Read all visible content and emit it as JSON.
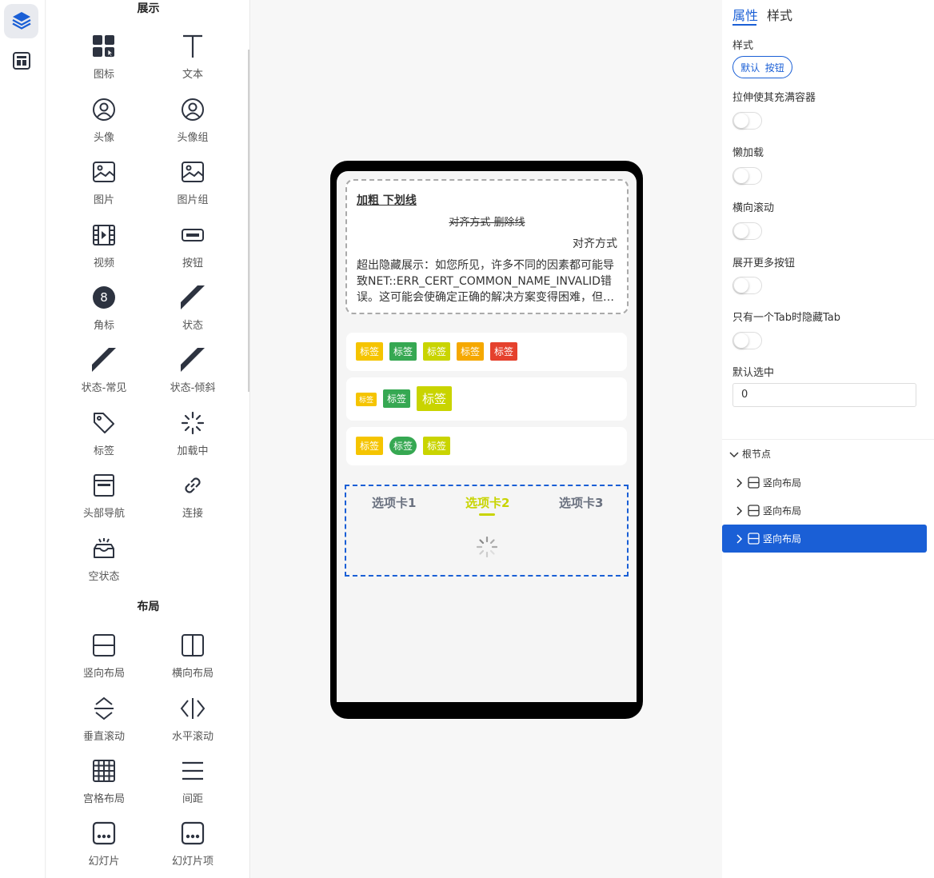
{
  "palette": {
    "display_title": "展示",
    "layout_title": "布局",
    "display_items": [
      {
        "label": "图标",
        "icon": "grid-apps-icon"
      },
      {
        "label": "文本",
        "icon": "text-t-icon"
      },
      {
        "label": "头像",
        "icon": "avatar-icon"
      },
      {
        "label": "头像组",
        "icon": "avatar-group-icon"
      },
      {
        "label": "图片",
        "icon": "image-icon"
      },
      {
        "label": "图片组",
        "icon": "image-group-icon"
      },
      {
        "label": "视频",
        "icon": "video-icon"
      },
      {
        "label": "按钮",
        "icon": "button-icon"
      },
      {
        "label": "角标",
        "icon": "badge-icon",
        "badge_text": "8"
      },
      {
        "label": "状态",
        "icon": "status-icon"
      },
      {
        "label": "状态-常见",
        "icon": "status-common-icon"
      },
      {
        "label": "状态-倾斜",
        "icon": "status-tilt-icon"
      },
      {
        "label": "标签",
        "icon": "tag-icon"
      },
      {
        "label": "加载中",
        "icon": "loading-icon"
      },
      {
        "label": "头部导航",
        "icon": "header-nav-icon"
      },
      {
        "label": "连接",
        "icon": "link-icon"
      },
      {
        "label": "空状态",
        "icon": "empty-inbox-icon"
      }
    ],
    "layout_items": [
      {
        "label": "竖向布局",
        "icon": "vertical-layout-icon"
      },
      {
        "label": "横向布局",
        "icon": "horizontal-layout-icon"
      },
      {
        "label": "垂直滚动",
        "icon": "vertical-scroll-icon"
      },
      {
        "label": "水平滚动",
        "icon": "horizontal-scroll-icon"
      },
      {
        "label": "宫格布局",
        "icon": "grid-layout-icon"
      },
      {
        "label": "间距",
        "icon": "spacing-icon"
      },
      {
        "label": "幻灯片",
        "icon": "slideshow-icon"
      },
      {
        "label": "幻灯片项",
        "icon": "slide-item-icon"
      }
    ]
  },
  "preview": {
    "text_line1": "加粗 下划线",
    "text_line2": "对齐方式 删除线",
    "text_line3": "对齐方式",
    "text_para": "超出隐藏展示：如您所见，许多不同的因素都可能导致NET::ERR_CERT_COMMON_NAME_INVALID错误。这可能会使确定正确的解决方案变得困难，但…",
    "tag_text": "标签",
    "tabs": [
      "选项卡1",
      "选项卡2",
      "选项卡3"
    ],
    "active_tab": 1,
    "colors": {
      "yellow": "#f5c400",
      "green": "#36a852",
      "lime": "#c9d400",
      "orange": "#f5a800",
      "red": "#e5412d"
    }
  },
  "props": {
    "tab_attr": "属性",
    "tab_style": "样式",
    "style_label": "样式",
    "style_seg_default": "默认",
    "style_seg_button": "按钮",
    "stretch_label": "拉伸使其充满容器",
    "lazy_label": "懒加载",
    "hscroll_label": "横向滚动",
    "expand_label": "展开更多按钮",
    "hide_tab_label": "只有一个Tab时隐藏Tab",
    "default_selected_label": "默认选中",
    "default_selected_value": "0"
  },
  "tree": {
    "root": "根节点",
    "nodes": [
      "竖向布局",
      "竖向布局",
      "竖向布局"
    ],
    "selected_index": 2
  },
  "accent": "#1a5fd6"
}
